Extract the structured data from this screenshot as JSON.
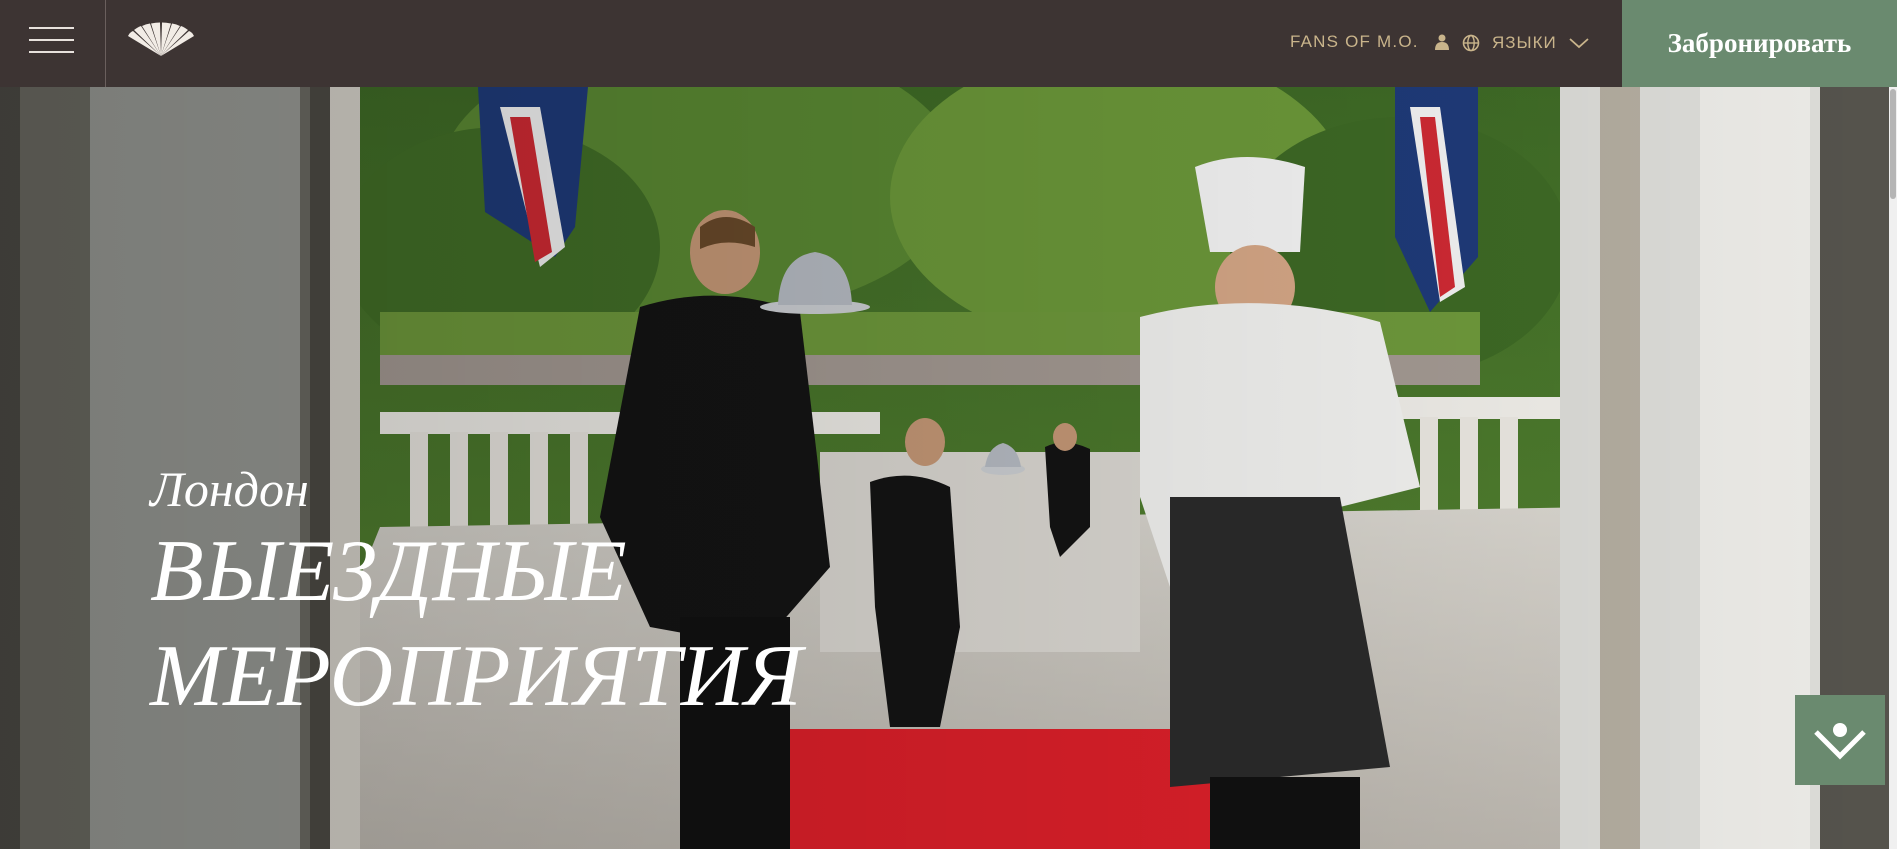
{
  "header": {
    "menu_icon": "hamburger-icon",
    "logo_icon": "mandarin-fan-icon",
    "fans_label": "FANS OF M.O.",
    "fans_icon": "user-icon",
    "lang_icon": "globe-icon",
    "lang_label": "ЯЗЫКИ",
    "lang_chevron": "chevron-down-icon",
    "book_label": "Забронировать"
  },
  "hero": {
    "kicker": "Лондон",
    "title_line1": "ВЫЕЗДНЫЕ",
    "title_line2": "МЕРОПРИЯТИЯ"
  },
  "scroll_button": {
    "icon": "scroll-down-person-icon"
  },
  "colors": {
    "header_bg": "#3d3433",
    "accent_gold": "#c9b48b",
    "brand_green": "#6a8a6f",
    "carpet_red": "#e0202a"
  }
}
